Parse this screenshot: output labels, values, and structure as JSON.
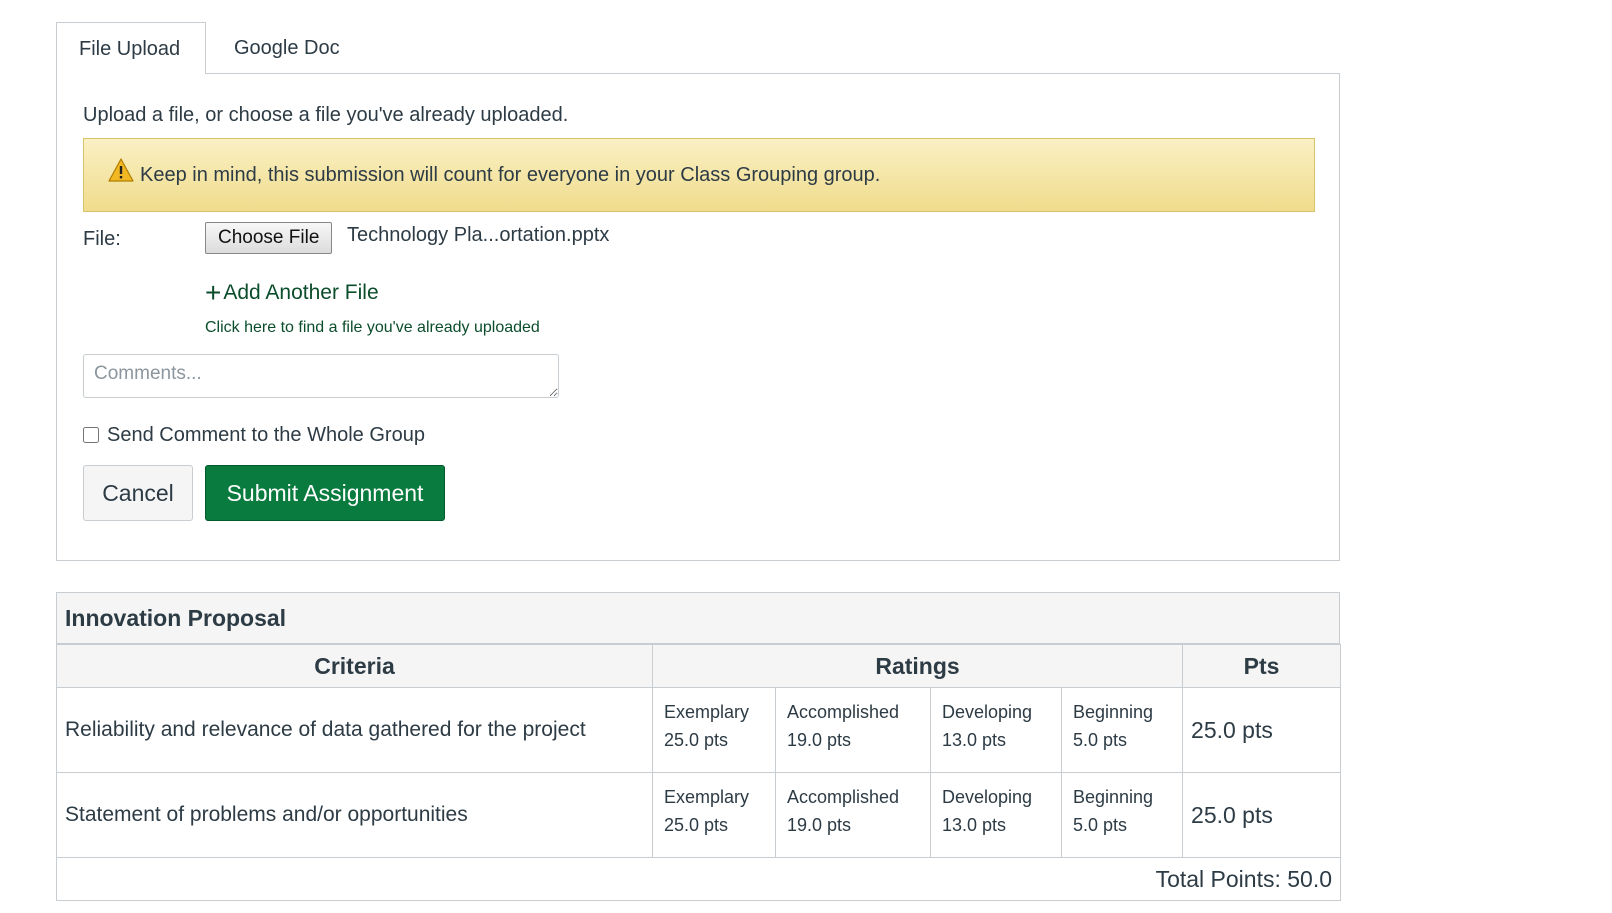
{
  "tabs": [
    {
      "label": "File Upload",
      "active": true
    },
    {
      "label": "Google Doc",
      "active": false
    }
  ],
  "upload": {
    "instructions": "Upload a file, or choose a file you've already uploaded.",
    "alert_text": "Keep in mind, this submission will count for everyone in your Class Grouping group.",
    "alert_icon": "warning-icon",
    "file_label": "File:",
    "choose_file_label": "Choose File",
    "selected_file": "Technology Pla...ortation.pptx",
    "add_file_label": "Add Another File",
    "find_file_link": "Click here to find a file you've already uploaded",
    "comments_placeholder": "Comments...",
    "comments_value": "",
    "send_to_group_label": "Send Comment to the Whole Group",
    "send_to_group_checked": false,
    "cancel_label": "Cancel",
    "submit_label": "Submit Assignment"
  },
  "colors": {
    "submit_bg": "#0a7b3e",
    "alert_bg": "#f5e6a6",
    "link": "#0b4d2b"
  },
  "rubric": {
    "title": "Innovation Proposal",
    "headers": {
      "criteria": "Criteria",
      "ratings": "Ratings",
      "pts": "Pts"
    },
    "rows": [
      {
        "criterion": "Reliability and relevance of data gathered for the project",
        "ratings": [
          {
            "name": "Exemplary",
            "pts": "25.0 pts"
          },
          {
            "name": "Accomplished",
            "pts": "19.0 pts"
          },
          {
            "name": "Developing",
            "pts": "13.0 pts"
          },
          {
            "name": "Beginning",
            "pts": "5.0 pts"
          }
        ],
        "pts": "25.0 pts"
      },
      {
        "criterion": "Statement of problems and/or opportunities",
        "ratings": [
          {
            "name": "Exemplary",
            "pts": "25.0 pts"
          },
          {
            "name": "Accomplished",
            "pts": "19.0 pts"
          },
          {
            "name": "Developing",
            "pts": "13.0 pts"
          },
          {
            "name": "Beginning",
            "pts": "5.0 pts"
          }
        ],
        "pts": "25.0 pts"
      }
    ],
    "total": "Total Points: 50.0"
  }
}
